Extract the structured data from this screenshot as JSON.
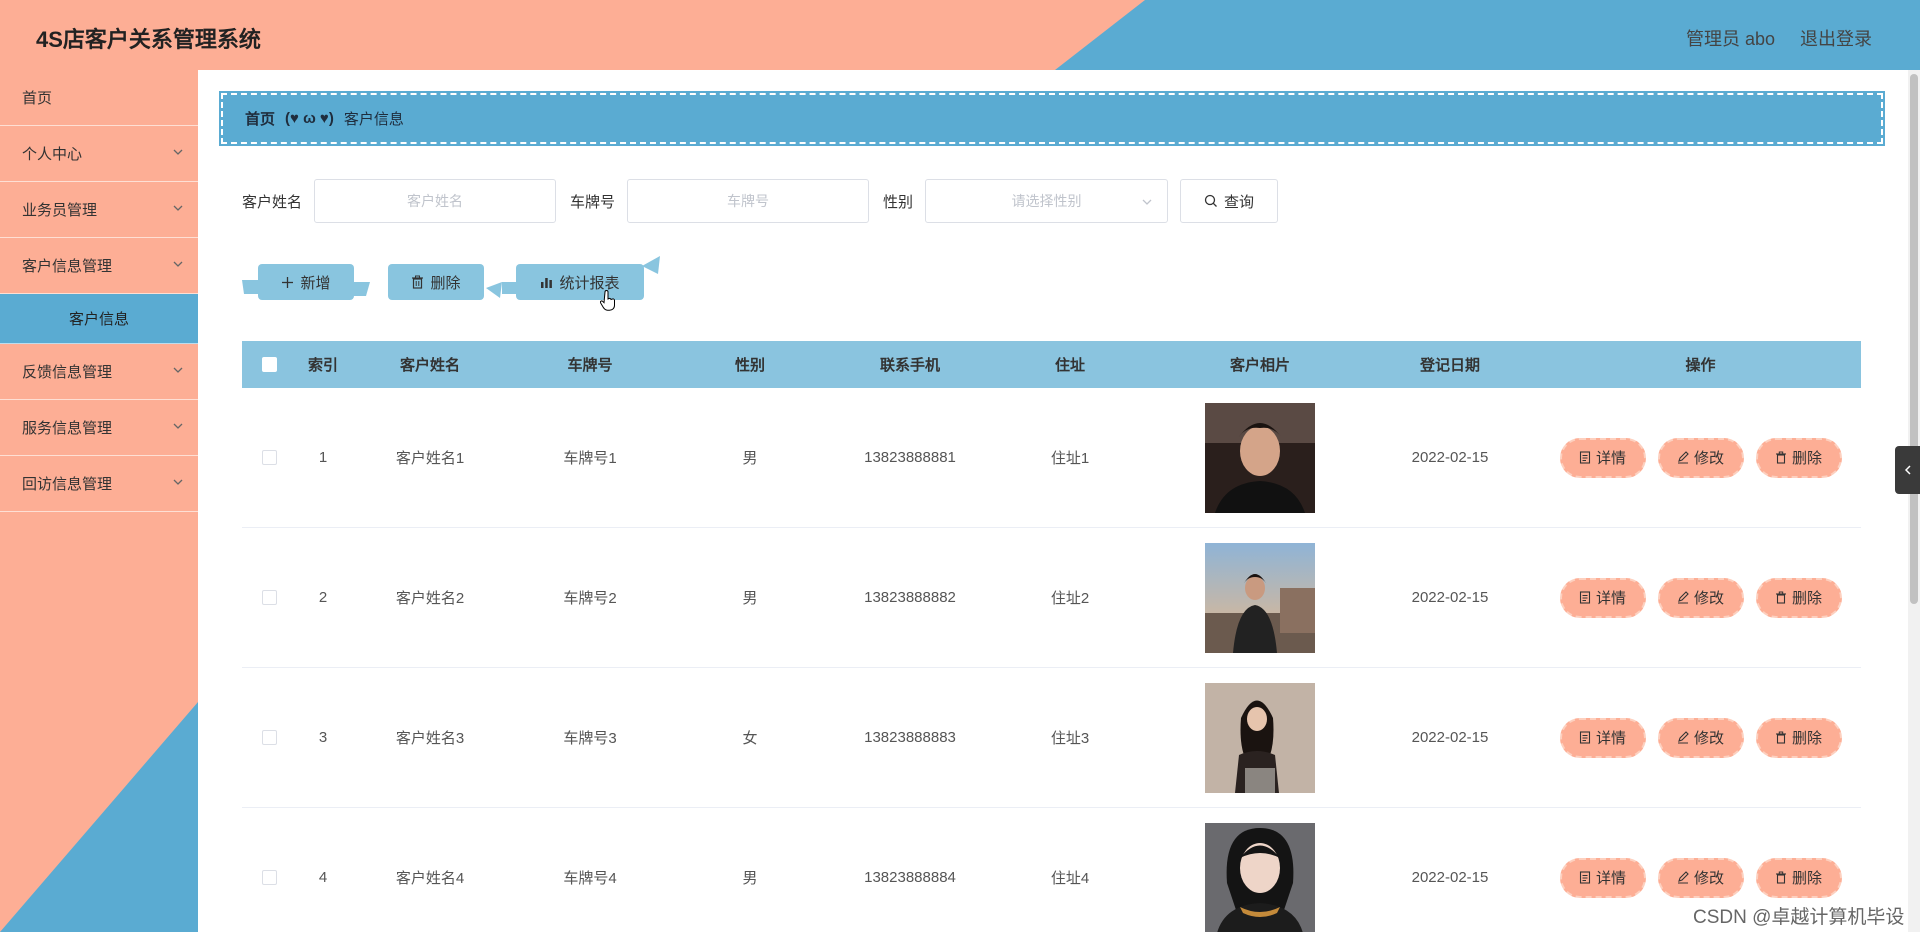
{
  "header": {
    "title": "4S店客户关系管理系统",
    "user": "管理员 abo",
    "logout": "退出登录",
    "colors": {
      "left": "#fdae95",
      "right": "#5aabd2"
    }
  },
  "sidebar": {
    "items": [
      {
        "label": "首页",
        "has_children": false
      },
      {
        "label": "个人中心",
        "has_children": true
      },
      {
        "label": "业务员管理",
        "has_children": true
      },
      {
        "label": "客户信息管理",
        "has_children": true
      },
      {
        "label": "客户信息",
        "submenu": true,
        "active": true
      },
      {
        "label": "反馈信息管理",
        "has_children": true
      },
      {
        "label": "服务信息管理",
        "has_children": true
      },
      {
        "label": "回访信息管理",
        "has_children": true
      }
    ]
  },
  "breadcrumb": {
    "home": "首页",
    "separator": "(♥ ω ♥)",
    "current": "客户信息"
  },
  "search": {
    "name_label": "客户姓名",
    "name_placeholder": "客户姓名",
    "plate_label": "车牌号",
    "plate_placeholder": "车牌号",
    "sex_label": "性别",
    "sex_placeholder": "请选择性别",
    "query_button": "查询"
  },
  "actions": {
    "add": "新增",
    "delete": "删除",
    "report": "统计报表"
  },
  "table": {
    "columns": [
      "索引",
      "客户姓名",
      "车牌号",
      "性别",
      "联系手机",
      "住址",
      "客户相片",
      "登记日期",
      "操作"
    ],
    "rows": [
      {
        "index": "1",
        "name": "客户姓名1",
        "plate": "车牌号1",
        "sex": "男",
        "phone": "13823888881",
        "address": "住址1",
        "date": "2022-02-15"
      },
      {
        "index": "2",
        "name": "客户姓名2",
        "plate": "车牌号2",
        "sex": "男",
        "phone": "13823888882",
        "address": "住址2",
        "date": "2022-02-15"
      },
      {
        "index": "3",
        "name": "客户姓名3",
        "plate": "车牌号3",
        "sex": "女",
        "phone": "13823888883",
        "address": "住址3",
        "date": "2022-02-15"
      },
      {
        "index": "4",
        "name": "客户姓名4",
        "plate": "车牌号4",
        "sex": "男",
        "phone": "13823888884",
        "address": "住址4",
        "date": "2022-02-15"
      }
    ],
    "ops": {
      "detail": "详情",
      "edit": "修改",
      "delete": "删除"
    }
  },
  "watermark": "CSDN @卓越计算机毕设"
}
